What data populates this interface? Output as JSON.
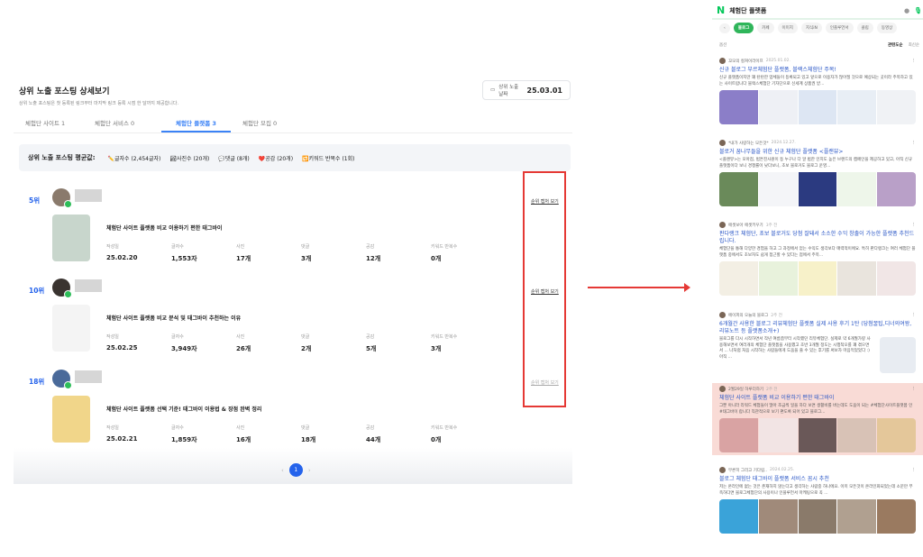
{
  "left": {
    "title": "상위 노출 포스팅 상세보기",
    "subtitle": "상위 노출 포스팅은 첫 등록된 링크부터 마지막 링크 등록 시점 한 달까지 제공합니다.",
    "date_label": "상위 노출 날짜",
    "date_value": "25.03.01",
    "tabs": [
      {
        "label": "체험단 사이트 1"
      },
      {
        "label": "체험단 서비스 0"
      },
      {
        "label": "체험단 플랫폼 3"
      },
      {
        "label": "체험단 모집 0"
      }
    ],
    "stats": {
      "heading": "상위 노출 포스팅 평균값:",
      "items": [
        {
          "icon": "✏️",
          "label": "글자수 (2,454글자)"
        },
        {
          "icon": "🏞",
          "label": "사진수 (20개)"
        },
        {
          "icon": "💬",
          "label": "댓글 (8개)"
        },
        {
          "icon": "❤️",
          "label": "공감 (20개)"
        },
        {
          "icon": "🔁",
          "label": "키워드 반복수 (1회)"
        }
      ]
    },
    "col_labels": [
      "작성일",
      "글자수",
      "사진",
      "댓글",
      "공감",
      "키워드 반복수"
    ],
    "capture_label": "순위 캡처 보기",
    "entries": [
      {
        "rank": "5위",
        "title": "체험단 사이트 플랫폼 비교 이용하기 편한 태그바이",
        "values": [
          "25.02.20",
          "1,553자",
          "17개",
          "3개",
          "12개",
          "0개"
        ]
      },
      {
        "rank": "10위",
        "title": "체험단 사이트 플랫폼 비교 분석 및 태그바이 추천하는 이유",
        "values": [
          "25.02.25",
          "3,949자",
          "26개",
          "2개",
          "5개",
          "3개"
        ]
      },
      {
        "rank": "18위",
        "title": "체험단 사이트 플랫폼 선택 기준! 태그바이 이용법 & 장점 완벽 정리",
        "values": [
          "25.02.21",
          "1,859자",
          "16개",
          "18개",
          "44개",
          "0개"
        ]
      }
    ],
    "page": "1"
  },
  "right": {
    "query": "체험단 플랫폼",
    "tabs": [
      "블로그",
      "카페",
      "이미지",
      "지식iN",
      "인플루언서",
      "클립",
      "동영상"
    ],
    "filter": "옵션",
    "sort_rel": "관련도순",
    "sort_new": "최신순",
    "results": [
      {
        "author": "꼬모의 컬쳐이라이프",
        "date": "2025.01.02.",
        "title": "신규 블로그 부르체험단 플랫폼, 블랙스체험단 주목!",
        "desc": "신규 플랫폼이지만 꽤 탄탄한 업체들이 등록되고 있고 앞으로 이용자가 많아질 것으로 예상되는 곳이라 주목하고 있는 사이트랍니다 블랙스체험단 기자단으로 신세계 상품권 받..."
      },
      {
        "author": "*내가 사랑하는 모든것*",
        "date": "2024.12.27.",
        "title": "블로거 꿈나무들을 위한 신규 체험단 플랫폼 <플랜뷰>",
        "desc": "<플랜뷰>는 모아점, 범튼진사원이 등 누구나 다 알 법한 인지도 높은 브랜드의 캠페인을 제공하고 있고, 아직 신규 플랫폼이다 보니 경쟁률이 낮다보니, 초보 블로거도 블로그 운영..."
      },
      {
        "author": "애셋보아 애셋키우기",
        "date": "3주 전",
        "title": "판다랭크 체험단, 초보 블로거도 당첨 잘돼서 소소한 수익 창출이 가능한 플랫폼 추천드립니다.",
        "desc": "체험단을 통해 다양한 경험을 하고 그 과정에서 얻는 수익도 생각보다 매력적이에요. 특히 판다랭크는 여러 체험단 플랫폼 중에서도 초보자도 쉽게 접근할 수 있다는 점에서 주목..."
      },
      {
        "author": "에이피의 오늘의 블로그",
        "date": "2주 전",
        "title": "6개월간 사용한 블로그 리뷰체험단 플랫폼 실제 사용 후기 1탄 (당첨꿀팁,디너의여왕,리뷰노트 등 플랫폼소개+)",
        "desc": "블로그를 다시 시작하면서 작년 여름쯤부터 시작했던 리뷰체험단. 실제로 약 6개월가량 사용해보면서 여러개의 체험단 플랫폼을 사용했고 초반 3개월 정도는 시행착오를 꽤 겪으면서 ... 나처럼 처음 시작하는 사람들에게 도움을 줄 수 있는 후기를 써보자 마음먹었었다 :) 아직 ..."
      },
      {
        "author": "2월29일 하루더하기",
        "date": "2주 전",
        "title": "체험단 사이트 플랫폼 비교 이용하기 편한 태그바이",
        "desc": "그뿐 아니라 리워드 체험들이 많아 조금씩 일을 하다 보면 생활비를 버는데도 도움이 되는 #체험단사이트플랫폼 인 #태그바이 랍니다 직관적으로 보기 편도록 되어 있고 블로그..."
      },
      {
        "author": "무른히 그리고 기다림..",
        "date": "2024.02.25.",
        "title": "블로그 체험단 태그바이 플랫폼 서비스 꼼시 추천",
        "desc": "저는 온라인에 없는 것은 존재하지 않는다고 생각하는 사람중 하나에요. 이미 모든것이 온라인화되었는데 소문만 부족하다면 블로그체험단의 사용이나 인플루언서 마케팅으로 꼭 ..."
      }
    ]
  },
  "colors": {
    "accent": "#2563eb",
    "highlight_box": "#e53935",
    "naver_green": "#03c75a",
    "highlight_row": "#f9dbd6"
  }
}
